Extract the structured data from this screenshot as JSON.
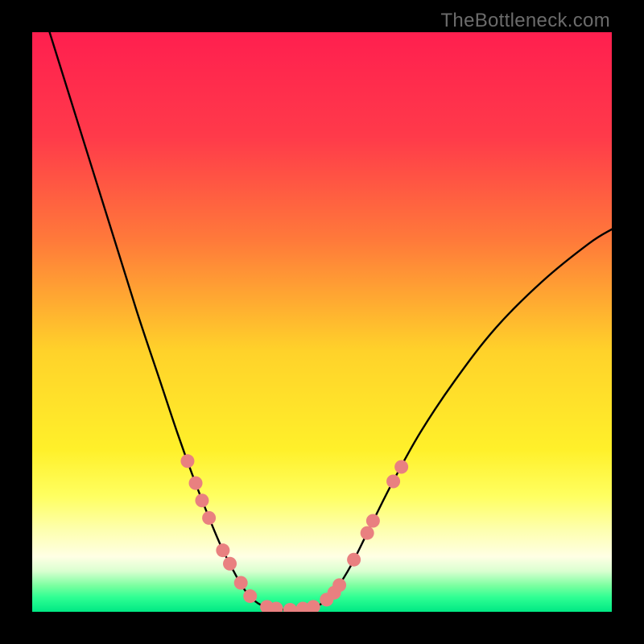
{
  "watermark": "TheBottleneck.com",
  "chart_data": {
    "type": "line",
    "title": "",
    "xlabel": "",
    "ylabel": "",
    "xlim": [
      0,
      100
    ],
    "ylim": [
      0,
      100
    ],
    "background_gradient_stops": [
      {
        "offset": 0.0,
        "color": "#ff1f4f"
      },
      {
        "offset": 0.18,
        "color": "#ff3a4a"
      },
      {
        "offset": 0.36,
        "color": "#ff7a3a"
      },
      {
        "offset": 0.55,
        "color": "#ffd22a"
      },
      {
        "offset": 0.72,
        "color": "#fff02a"
      },
      {
        "offset": 0.8,
        "color": "#ffff60"
      },
      {
        "offset": 0.86,
        "color": "#fdffb0"
      },
      {
        "offset": 0.905,
        "color": "#ffffe4"
      },
      {
        "offset": 0.93,
        "color": "#d9ffd0"
      },
      {
        "offset": 0.955,
        "color": "#7affa0"
      },
      {
        "offset": 0.975,
        "color": "#2fff93"
      },
      {
        "offset": 1.0,
        "color": "#00e884"
      }
    ],
    "series": [
      {
        "name": "bottleneck-curve",
        "color": "#000000",
        "points": [
          {
            "x": 3.0,
            "y": 100.0
          },
          {
            "x": 8.0,
            "y": 84.0
          },
          {
            "x": 13.0,
            "y": 68.0
          },
          {
            "x": 18.0,
            "y": 52.0
          },
          {
            "x": 22.0,
            "y": 40.0
          },
          {
            "x": 25.0,
            "y": 31.0
          },
          {
            "x": 27.5,
            "y": 24.0
          },
          {
            "x": 30.0,
            "y": 17.5
          },
          {
            "x": 32.5,
            "y": 11.5
          },
          {
            "x": 34.5,
            "y": 7.5
          },
          {
            "x": 36.5,
            "y": 4.0
          },
          {
            "x": 38.5,
            "y": 1.8
          },
          {
            "x": 40.5,
            "y": 0.8
          },
          {
            "x": 43.0,
            "y": 0.4
          },
          {
            "x": 46.0,
            "y": 0.4
          },
          {
            "x": 48.5,
            "y": 0.8
          },
          {
            "x": 50.5,
            "y": 1.8
          },
          {
            "x": 52.5,
            "y": 4.0
          },
          {
            "x": 55.0,
            "y": 8.0
          },
          {
            "x": 58.0,
            "y": 14.0
          },
          {
            "x": 62.0,
            "y": 22.0
          },
          {
            "x": 67.0,
            "y": 31.0
          },
          {
            "x": 73.0,
            "y": 40.0
          },
          {
            "x": 80.0,
            "y": 49.0
          },
          {
            "x": 88.0,
            "y": 57.0
          },
          {
            "x": 96.0,
            "y": 63.5
          },
          {
            "x": 100.0,
            "y": 66.0
          }
        ]
      }
    ],
    "dot_markers": {
      "color": "#e98080",
      "radius_px": 8.5,
      "points": [
        {
          "x": 26.8,
          "y": 26.0
        },
        {
          "x": 28.2,
          "y": 22.2
        },
        {
          "x": 29.3,
          "y": 19.2
        },
        {
          "x": 30.5,
          "y": 16.2
        },
        {
          "x": 32.9,
          "y": 10.6
        },
        {
          "x": 34.1,
          "y": 8.3
        },
        {
          "x": 36.0,
          "y": 5.0
        },
        {
          "x": 37.6,
          "y": 2.7
        },
        {
          "x": 40.5,
          "y": 0.85
        },
        {
          "x": 42.1,
          "y": 0.55
        },
        {
          "x": 44.5,
          "y": 0.35
        },
        {
          "x": 46.7,
          "y": 0.55
        },
        {
          "x": 48.5,
          "y": 0.85
        },
        {
          "x": 50.8,
          "y": 2.1
        },
        {
          "x": 52.1,
          "y": 3.3
        },
        {
          "x": 53.0,
          "y": 4.6
        },
        {
          "x": 55.5,
          "y": 9.0
        },
        {
          "x": 57.8,
          "y": 13.6
        },
        {
          "x": 58.8,
          "y": 15.7
        },
        {
          "x": 62.3,
          "y": 22.5
        },
        {
          "x": 63.7,
          "y": 25.0
        }
      ]
    }
  }
}
